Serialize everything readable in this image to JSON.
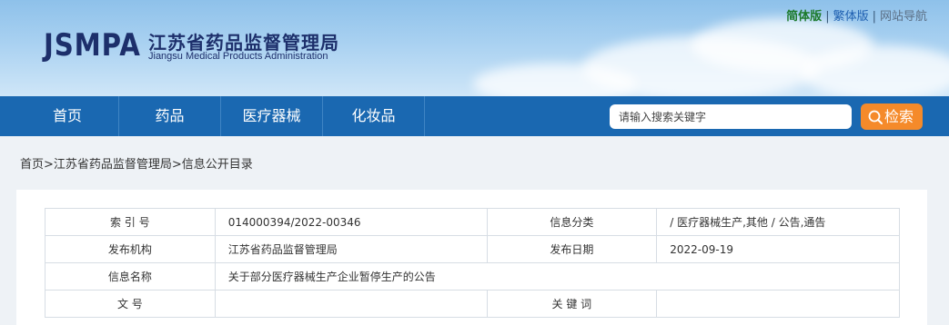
{
  "header": {
    "logo_abbr": "JSMPA",
    "logo_cn": "江苏省药品监督管理局",
    "logo_en": "Jiangsu Medical Products Administration",
    "links": {
      "simplified": "简体版",
      "traditional": "繁体版",
      "sitemap": "网站导航",
      "separator": "|"
    }
  },
  "nav": {
    "items": [
      "首页",
      "药品",
      "医疗器械",
      "化妆品"
    ],
    "search_placeholder": "请输入搜索关键字",
    "search_button": "检索"
  },
  "breadcrumb": "首页>江苏省药品监督管理局>信息公开目录",
  "info_table": {
    "rows": [
      {
        "label1": "索 引 号",
        "value1": "014000394/2022-00346",
        "label2": "信息分类",
        "value2": "/ 医疗器械生产,其他 / 公告,通告"
      },
      {
        "label1": "发布机构",
        "value1": "江苏省药品监督管理局",
        "label2": "发布日期",
        "value2": "2022-09-19"
      },
      {
        "label1": "信息名称",
        "value1": "关于部分医疗器械生产企业暂停生产的公告"
      },
      {
        "label1": "文 号",
        "value1": "",
        "label2": "关 键 词",
        "value2": ""
      }
    ]
  },
  "colors": {
    "nav_bg": "#1a68b1",
    "search_button": "#f58a2a",
    "logo": "#1d2f6b"
  }
}
